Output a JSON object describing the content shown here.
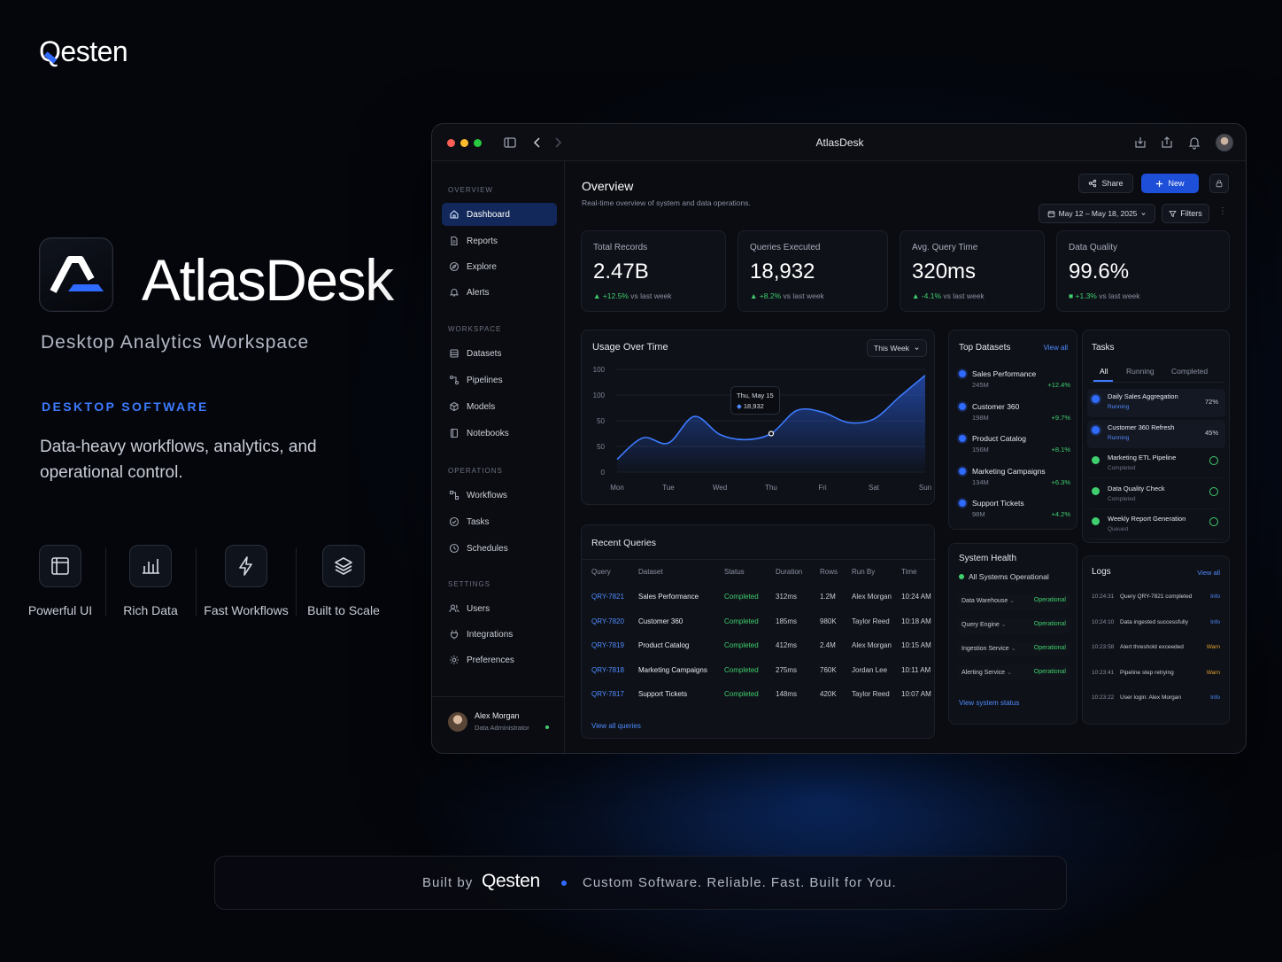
{
  "brand": {
    "name": "Qesten"
  },
  "hero": {
    "title": "AtlasDesk",
    "subtitle": "Desktop Analytics Workspace",
    "kicker": "DESKTOP SOFTWARE",
    "description": "Data-heavy workflows, analytics, and operational control.",
    "features": [
      {
        "label": "Powerful UI",
        "icon": "layout-panel-icon"
      },
      {
        "label": "Rich Data",
        "icon": "bar-chart-icon"
      },
      {
        "label": "Fast Workflows",
        "icon": "lightning-bolt-icon"
      },
      {
        "label": "Built to Scale",
        "icon": "layers-stack-icon"
      }
    ]
  },
  "window": {
    "title": "AtlasDesk",
    "traffic_colors": [
      "#ff5f57",
      "#febc2e",
      "#28c840"
    ]
  },
  "sidebar": {
    "sections": [
      {
        "title": "OVERVIEW",
        "items": [
          {
            "label": "Dashboard",
            "icon": "home-icon",
            "active": true
          },
          {
            "label": "Reports",
            "icon": "document-icon"
          },
          {
            "label": "Explore",
            "icon": "compass-icon"
          },
          {
            "label": "Alerts",
            "icon": "bell-icon"
          }
        ]
      },
      {
        "title": "WORKSPACE",
        "items": [
          {
            "label": "Datasets",
            "icon": "database-icon"
          },
          {
            "label": "Pipelines",
            "icon": "pipeline-icon"
          },
          {
            "label": "Models",
            "icon": "cube-icon"
          },
          {
            "label": "Notebooks",
            "icon": "notebook-icon"
          }
        ]
      },
      {
        "title": "OPERATIONS",
        "items": [
          {
            "label": "Workflows",
            "icon": "workflow-icon"
          },
          {
            "label": "Tasks",
            "icon": "check-circle-icon"
          },
          {
            "label": "Schedules",
            "icon": "clock-icon"
          }
        ]
      },
      {
        "title": "SETTINGS",
        "items": [
          {
            "label": "Users",
            "icon": "users-icon"
          },
          {
            "label": "Integrations",
            "icon": "plug-icon"
          },
          {
            "label": "Preferences",
            "icon": "gear-icon"
          }
        ]
      }
    ],
    "user": {
      "name": "Alex Morgan",
      "role": "Data Administrator"
    }
  },
  "header": {
    "title": "Overview",
    "subtitle": "Real-time overview of system and data operations.",
    "share_label": "Share",
    "new_label": "New",
    "date_range": "May 12 – May 18, 2025",
    "filters_label": "Filters"
  },
  "kpis": [
    {
      "label": "Total Records",
      "value": "2.47B",
      "delta": "+12.5%",
      "suffix": "vs last week"
    },
    {
      "label": "Queries Executed",
      "value": "18,932",
      "delta": "+8.2%",
      "suffix": "vs last week"
    },
    {
      "label": "Avg. Query Time",
      "value": "320ms",
      "delta": "-4.1%",
      "suffix": "vs last week"
    },
    {
      "label": "Data Quality",
      "value": "99.6%",
      "delta": "+1.3%",
      "suffix": "vs last week"
    }
  ],
  "usage": {
    "title": "Usage Over Time",
    "period": "This Week",
    "tooltip_date": "Thu, May 15",
    "tooltip_value": "18,932"
  },
  "chart_data": {
    "type": "area",
    "title": "Usage Over Time",
    "categories": [
      "Mon",
      "Tue",
      "Wed",
      "Thu",
      "Fri",
      "Sat",
      "Sun"
    ],
    "y_tick_labels": [
      "100",
      "100",
      "50",
      "50",
      "0"
    ],
    "x": [
      0,
      0.5,
      1,
      1.5,
      2,
      2.5,
      3,
      3.5,
      4,
      4.5,
      5,
      5.5,
      6
    ],
    "values": [
      15,
      40,
      34,
      65,
      44,
      38,
      45,
      72,
      70,
      58,
      62,
      88,
      113
    ],
    "ylim": [
      0,
      120
    ],
    "grid": true
  },
  "top_datasets": {
    "title": "Top Datasets",
    "view_all": "View all",
    "items": [
      {
        "name": "Sales Performance",
        "size": "245M",
        "delta": "+12.4%"
      },
      {
        "name": "Customer 360",
        "size": "198M",
        "delta": "+9.7%"
      },
      {
        "name": "Product Catalog",
        "size": "156M",
        "delta": "+8.1%"
      },
      {
        "name": "Marketing Campaigns",
        "size": "134M",
        "delta": "+6.3%"
      },
      {
        "name": "Support Tickets",
        "size": "98M",
        "delta": "+4.2%"
      }
    ]
  },
  "tasks": {
    "title": "Tasks",
    "tabs": [
      "All",
      "Running",
      "Completed"
    ],
    "items": [
      {
        "name": "Daily Sales Aggregation",
        "status": "Running",
        "progress": "72%"
      },
      {
        "name": "Customer 360 Refresh",
        "status": "Running",
        "progress": "45%"
      },
      {
        "name": "Marketing ETL Pipeline",
        "status": "Completed",
        "progress": ""
      },
      {
        "name": "Data Quality Check",
        "status": "Completed",
        "progress": ""
      },
      {
        "name": "Weekly Report Generation",
        "status": "Queued",
        "progress": ""
      }
    ]
  },
  "recent_queries": {
    "title": "Recent Queries",
    "columns": [
      "Query",
      "Dataset",
      "Status",
      "Duration",
      "Rows",
      "Run By",
      "Time"
    ],
    "rows": [
      [
        "QRY-7821",
        "Sales Performance",
        "Completed",
        "312ms",
        "1.2M",
        "Alex Morgan",
        "10:24 AM"
      ],
      [
        "QRY-7820",
        "Customer 360",
        "Completed",
        "185ms",
        "980K",
        "Taylor Reed",
        "10:18 AM"
      ],
      [
        "QRY-7819",
        "Product Catalog",
        "Completed",
        "412ms",
        "2.4M",
        "Alex Morgan",
        "10:15 AM"
      ],
      [
        "QRY-7818",
        "Marketing Campaigns",
        "Completed",
        "275ms",
        "760K",
        "Jordan Lee",
        "10:11 AM"
      ],
      [
        "QRY-7817",
        "Support Tickets",
        "Completed",
        "148ms",
        "420K",
        "Taylor Reed",
        "10:07 AM"
      ]
    ],
    "view_all": "View all queries"
  },
  "system_health": {
    "title": "System Health",
    "overall": "All Systems Operational",
    "services": [
      {
        "name": "Data Warehouse",
        "status": "Operational"
      },
      {
        "name": "Query Engine",
        "status": "Operational"
      },
      {
        "name": "Ingestion Service",
        "status": "Operational"
      },
      {
        "name": "Alerting Service",
        "status": "Operational"
      }
    ],
    "view_status": "View system status"
  },
  "logs": {
    "title": "Logs",
    "view_all": "View all",
    "items": [
      {
        "time": "10:24:31",
        "message": "Query QRY-7821 completed",
        "level": "Info"
      },
      {
        "time": "10:24:10",
        "message": "Data ingested successfully",
        "level": "Info"
      },
      {
        "time": "10:23:58",
        "message": "Alert threshold exceeded",
        "level": "Warn"
      },
      {
        "time": "10:23:41",
        "message": "Pipeline step retrying",
        "level": "Warn"
      },
      {
        "time": "10:23:22",
        "message": "User login: Alex Morgan",
        "level": "Info"
      }
    ]
  },
  "footer": {
    "built_by": "Built by",
    "brand": "Qesten",
    "tagline": "Custom Software. Reliable. Fast. Built for You."
  },
  "colors": {
    "accent": "#3d7bff",
    "success": "#3fcf6e",
    "warning": "#e0a030",
    "background": "#04060c"
  }
}
